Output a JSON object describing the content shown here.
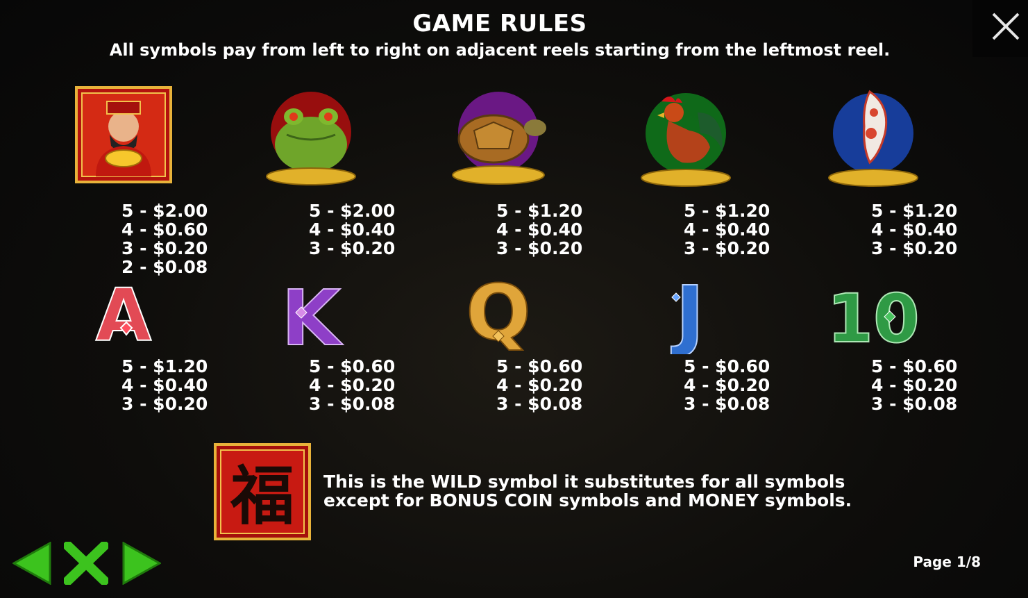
{
  "header": {
    "title": "GAME RULES",
    "subtitle": "All symbols pay from left to right on adjacent reels starting from the leftmost reel."
  },
  "close_icon": "close-icon",
  "symbols_row1": [
    {
      "name": "fortune-god",
      "icon": "fortune-god-icon",
      "pays": [
        "5 - $2.00",
        "4 - $0.60",
        "3 - $0.20",
        "2 - $0.08"
      ]
    },
    {
      "name": "frog",
      "icon": "frog-icon",
      "pays": [
        "5 - $2.00",
        "4 - $0.40",
        "3 - $0.20"
      ]
    },
    {
      "name": "turtle",
      "icon": "turtle-icon",
      "pays": [
        "5 - $1.20",
        "4 - $0.40",
        "3 - $0.20"
      ]
    },
    {
      "name": "rooster",
      "icon": "rooster-icon",
      "pays": [
        "5 - $1.20",
        "4 - $0.40",
        "3 - $0.20"
      ]
    },
    {
      "name": "koi",
      "icon": "koi-icon",
      "pays": [
        "5 - $1.20",
        "4 - $0.40",
        "3 - $0.20"
      ]
    }
  ],
  "symbols_row2": [
    {
      "name": "A",
      "glyph": "A",
      "color": "#e24a55",
      "pays": [
        "5 - $1.20",
        "4 - $0.40",
        "3 - $0.20"
      ]
    },
    {
      "name": "K",
      "glyph": "K",
      "color": "#8e3fc7",
      "pays": [
        "5 - $0.60",
        "4 - $0.20",
        "3 - $0.08"
      ]
    },
    {
      "name": "Q",
      "glyph": "Q",
      "color": "#e0a53a",
      "pays": [
        "5 - $0.60",
        "4 - $0.20",
        "3 - $0.08"
      ]
    },
    {
      "name": "J",
      "glyph": "J",
      "color": "#2f6fd0",
      "pays": [
        "5 - $0.60",
        "4 - $0.20",
        "3 - $0.08"
      ]
    },
    {
      "name": "10",
      "glyph": "10",
      "color": "#2f9a45",
      "pays": [
        "5 - $0.60",
        "4 - $0.20",
        "3 - $0.08"
      ]
    }
  ],
  "wild": {
    "glyph": "福",
    "line1": "This is the WILD symbol it substitutes for all symbols",
    "line2": "except for BONUS COIN symbols and MONEY symbols."
  },
  "navigation": {
    "prev_icon": "arrow-left-icon",
    "close_icon": "green-close-icon",
    "next_icon": "arrow-right-icon",
    "accent": "#3cc31e"
  },
  "page_indicator": "Page 1/8"
}
